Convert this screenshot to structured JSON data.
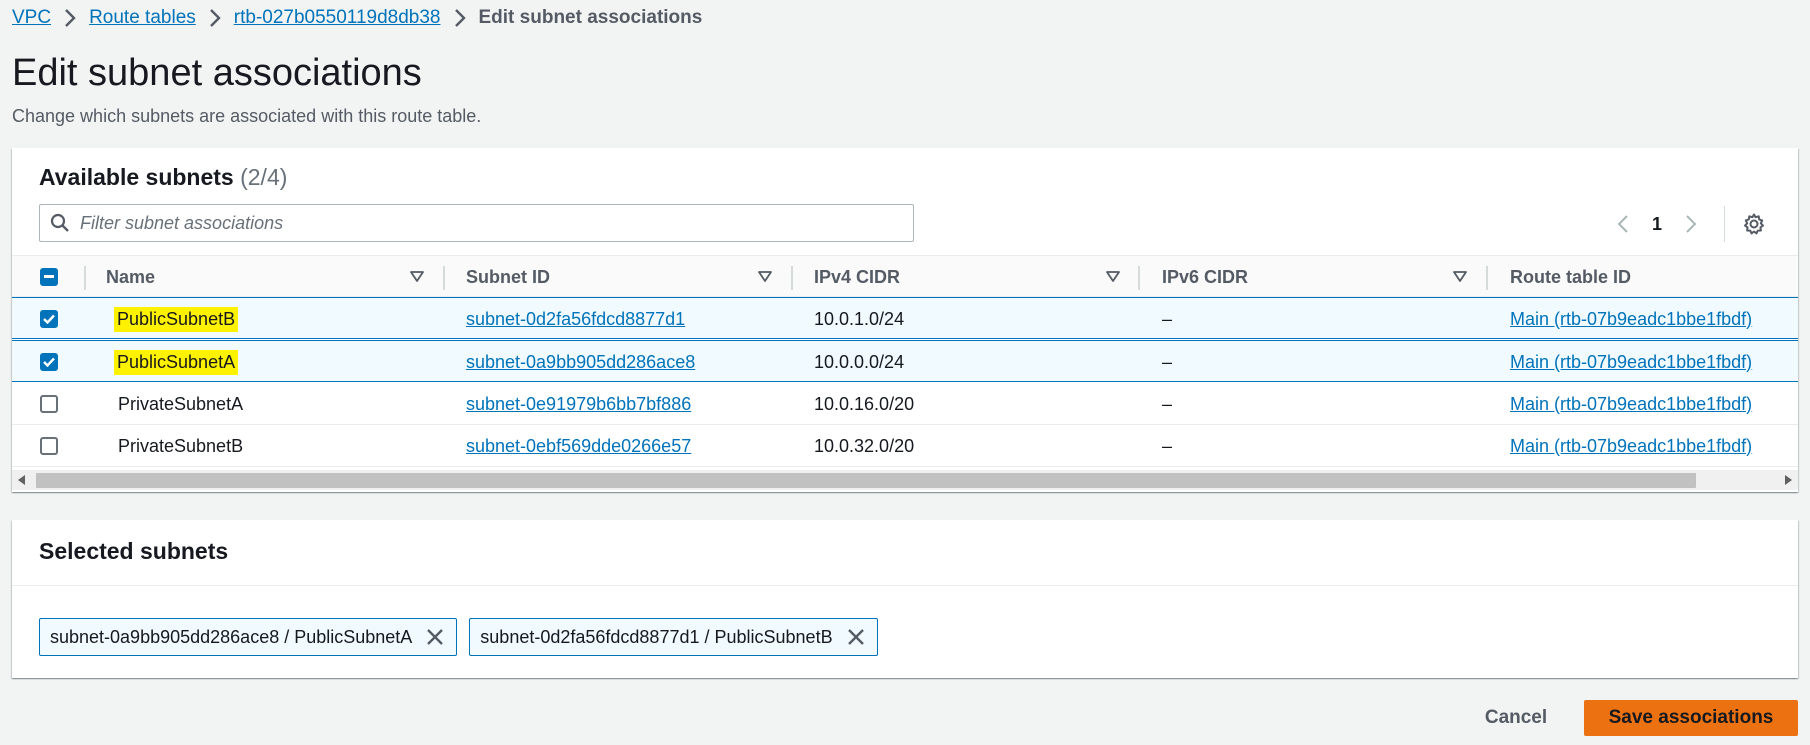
{
  "breadcrumb": {
    "items": [
      {
        "label": "VPC"
      },
      {
        "label": "Route tables"
      },
      {
        "label": "rtb-027b0550119d8db38"
      }
    ],
    "current": "Edit subnet associations"
  },
  "page": {
    "title": "Edit subnet associations",
    "description": "Change which subnets are associated with this route table."
  },
  "available": {
    "title": "Available subnets",
    "count": "(2/4)",
    "filter_placeholder": "Filter subnet associations",
    "filter_value": "",
    "page_number": "1",
    "columns": [
      "Name",
      "Subnet ID",
      "IPv4 CIDR",
      "IPv6 CIDR",
      "Route table ID"
    ],
    "rows": [
      {
        "name": "PublicSubnetB",
        "subnet_id": "subnet-0d2fa56fdcd8877d1",
        "ipv4": "10.0.1.0/24",
        "ipv6": "–",
        "route_table": "Main (rtb-07b9eadc1bbe1fbdf)",
        "checked": true,
        "highlighted": true
      },
      {
        "name": "PublicSubnetA",
        "subnet_id": "subnet-0a9bb905dd286ace8",
        "ipv4": "10.0.0.0/24",
        "ipv6": "–",
        "route_table": "Main (rtb-07b9eadc1bbe1fbdf)",
        "checked": true,
        "highlighted": true
      },
      {
        "name": "PrivateSubnetA",
        "subnet_id": "subnet-0e91979b6bb7bf886",
        "ipv4": "10.0.16.0/20",
        "ipv6": "–",
        "route_table": "Main (rtb-07b9eadc1bbe1fbdf)",
        "checked": false,
        "highlighted": false
      },
      {
        "name": "PrivateSubnetB",
        "subnet_id": "subnet-0ebf569dde0266e57",
        "ipv4": "10.0.32.0/20",
        "ipv6": "–",
        "route_table": "Main (rtb-07b9eadc1bbe1fbdf)",
        "checked": false,
        "highlighted": false
      }
    ]
  },
  "selected": {
    "title": "Selected subnets",
    "tokens": [
      {
        "label": "subnet-0a9bb905dd286ace8 / PublicSubnetA"
      },
      {
        "label": "subnet-0d2fa56fdcd8877d1 / PublicSubnetB"
      }
    ]
  },
  "footer": {
    "cancel_label": "Cancel",
    "save_label": "Save associations"
  },
  "colors": {
    "link": "#0073bb",
    "primary_button": "#ec7211",
    "highlight": "#fff200",
    "selected_row_bg": "#f1faff"
  },
  "icons": {
    "breadcrumb_separator": "chevron-right-icon",
    "search": "search-icon",
    "pager_prev": "chevron-left-icon",
    "pager_next": "chevron-right-icon",
    "settings": "gear-icon",
    "sort": "sort-down-icon",
    "token_dismiss": "close-icon"
  }
}
